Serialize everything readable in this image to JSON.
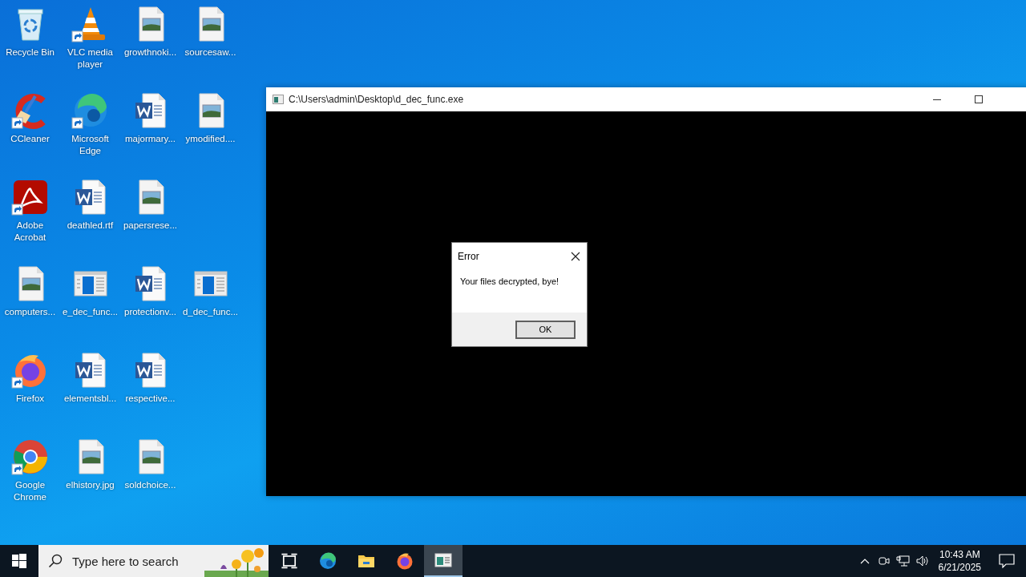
{
  "desktop_icons": [
    [
      {
        "kind": "recycle-bin",
        "label": "Recycle Bin",
        "shortcut": false
      },
      {
        "kind": "vlc",
        "label": "VLC media player",
        "shortcut": true
      },
      {
        "kind": "image-file",
        "label": "growthnoki...",
        "shortcut": false
      },
      {
        "kind": "image-file",
        "label": "sourcesaw...",
        "shortcut": false
      }
    ],
    [
      {
        "kind": "ccleaner",
        "label": "CCleaner",
        "shortcut": true
      },
      {
        "kind": "edge",
        "label": "Microsoft Edge",
        "shortcut": true
      },
      {
        "kind": "word-file",
        "label": "majormary...",
        "shortcut": false
      },
      {
        "kind": "image-file",
        "label": "ymodified....",
        "shortcut": false
      }
    ],
    [
      {
        "kind": "acrobat",
        "label": "Adobe Acrobat",
        "shortcut": true
      },
      {
        "kind": "word-file",
        "label": "deathled.rtf",
        "shortcut": false
      },
      {
        "kind": "image-file",
        "label": "papersrese...",
        "shortcut": false
      }
    ],
    [
      {
        "kind": "image-file",
        "label": "computers...",
        "shortcut": false
      },
      {
        "kind": "exe-file",
        "label": "e_dec_func...",
        "shortcut": false
      },
      {
        "kind": "word-file",
        "label": "protectionv...",
        "shortcut": false
      },
      {
        "kind": "exe-file",
        "label": "d_dec_func...",
        "shortcut": false
      }
    ],
    [
      {
        "kind": "firefox",
        "label": "Firefox",
        "shortcut": true
      },
      {
        "kind": "word-file",
        "label": "elementsbl...",
        "shortcut": false
      },
      {
        "kind": "word-file",
        "label": "respective...",
        "shortcut": false
      }
    ],
    [
      {
        "kind": "chrome",
        "label": "Google Chrome",
        "shortcut": true
      },
      {
        "kind": "image-file",
        "label": "elhistory.jpg",
        "shortcut": false
      },
      {
        "kind": "image-file",
        "label": "soldchoice...",
        "shortcut": false
      }
    ]
  ],
  "console_window": {
    "title": "C:\\Users\\admin\\Desktop\\d_dec_func.exe"
  },
  "dialog": {
    "title": "Error",
    "message": "Your files decrypted, bye!",
    "buttons": [
      "OK"
    ]
  },
  "taskbar": {
    "search": {
      "placeholder": "Type here to search"
    },
    "apps": [
      {
        "kind": "task-view",
        "active": false
      },
      {
        "kind": "edge",
        "active": false
      },
      {
        "kind": "folder",
        "active": false
      },
      {
        "kind": "firefox",
        "active": false
      },
      {
        "kind": "console",
        "active": true
      }
    ],
    "clock": {
      "time": "10:43 AM",
      "date": "6/21/2025"
    }
  }
}
